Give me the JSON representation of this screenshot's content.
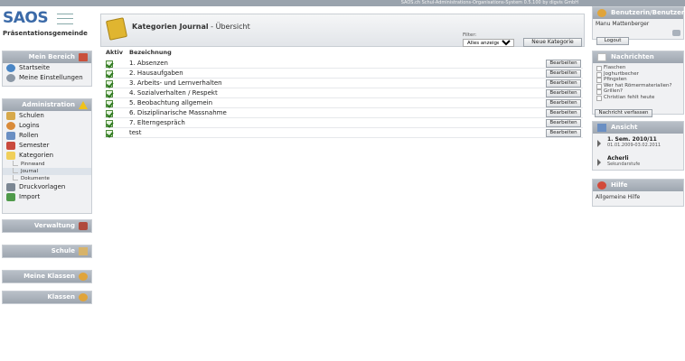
{
  "topbar": {
    "text": "SAOS.ch Schul-Administrations-Organisations-System 0.5.100 by digvis GmbH"
  },
  "logo": {
    "text": "SAOS",
    "school": "Präsentationsgemeinde"
  },
  "left": {
    "mein_bereich": {
      "title": "Mein Bereich",
      "items": [
        "Startseite",
        "Meine Einstellungen"
      ]
    },
    "administration": {
      "title": "Administration",
      "items": [
        "Schulen",
        "Logins",
        "Rollen",
        "Semester",
        "Kategorien"
      ],
      "sub": [
        "Pinnwand",
        "Journal",
        "Dokumente"
      ],
      "items2": [
        "Druckvorlagen",
        "Import"
      ]
    },
    "panels": [
      "Verwaltung",
      "Schule",
      "Meine Klassen",
      "Klassen"
    ]
  },
  "main": {
    "title": "Kategorien Journal",
    "subtitle": " - Übersicht",
    "filter_label": "Filter:",
    "filter_value": "Alles anzeigen",
    "new_button": "Neue Kategorie",
    "col_active": "Aktiv",
    "col_label": "Bezeichnung",
    "edit_label": "Bearbeiten",
    "rows": [
      "1. Absenzen",
      "2. Hausaufgaben",
      "3. Arbeits- und Lernverhalten",
      "4. Sozialverhalten / Respekt",
      "5. Beobachtung allgemein",
      "6. Disziplinarische Massnahme",
      "7. Elterngespräch",
      "test"
    ]
  },
  "right": {
    "user": {
      "title": "Benutzerin/Benutzer",
      "name": "Manu Mattenberger",
      "logout": "Logout"
    },
    "news": {
      "title": "Nachrichten",
      "items": [
        "Flaschen",
        "Joghurtbecher",
        "Pfingsten",
        "Wer hat Römermaterialien?",
        "Grillen?",
        "Christian fehlt heute"
      ],
      "button": "Nachricht verfassen"
    },
    "view": {
      "title": "Ansicht",
      "sem": "1. Sem. 2010/11",
      "dates": "01.01.2009-03.02.2011",
      "school": "Acherli",
      "level": "Sekundarstufe"
    },
    "help": {
      "title": "Hilfe",
      "link": "Allgemeine Hilfe"
    }
  },
  "colors": {
    "header": "#9ea6b0",
    "accent": "#3b6aa8",
    "check": "#2d7a1e"
  }
}
